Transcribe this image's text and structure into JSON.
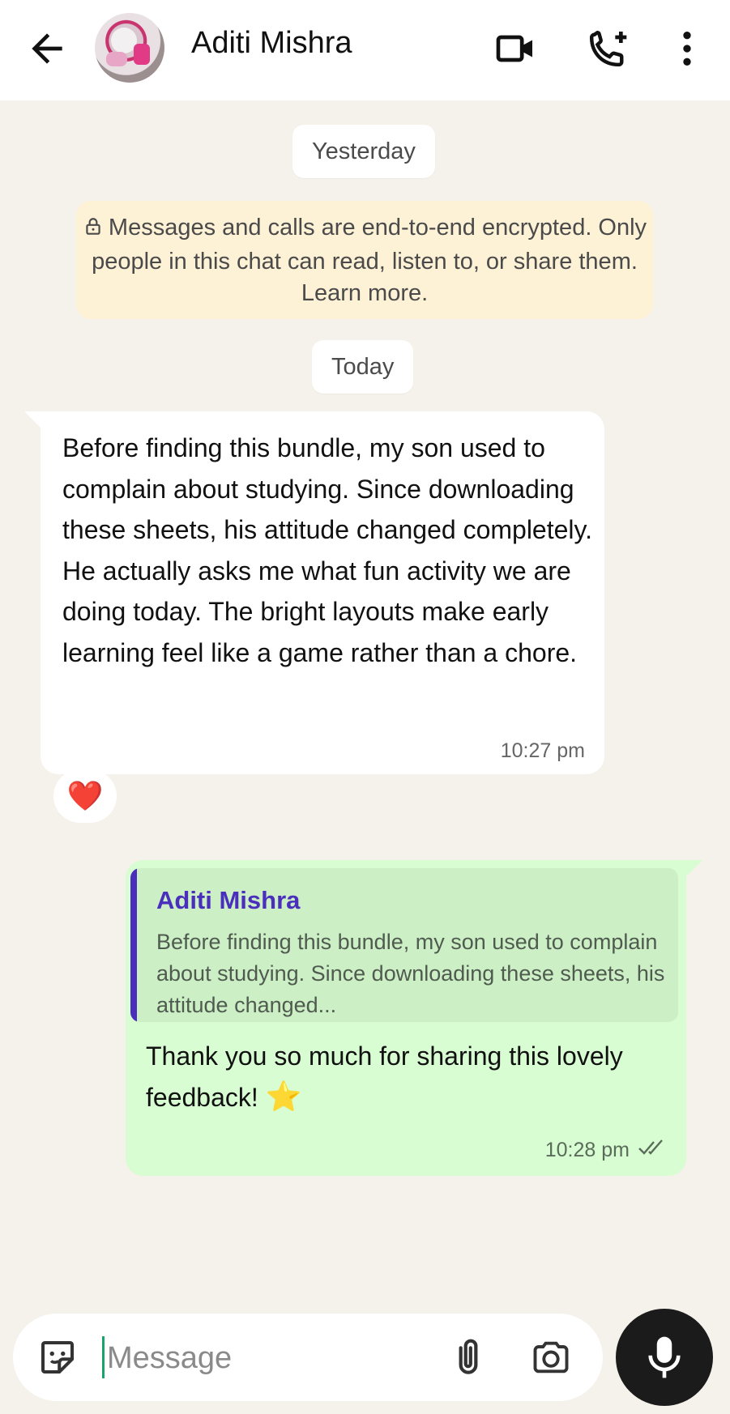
{
  "header": {
    "contact_name": "Aditi Mishra",
    "icons": [
      "back-arrow-icon",
      "video-call-icon",
      "add-call-icon",
      "more-options-icon"
    ]
  },
  "chat": {
    "date_yesterday": "Yesterday",
    "encryption_notice": "Messages and calls are end-to-end encrypted. Only people in this chat can read, listen to, or share them. Learn more.",
    "date_today": "Today",
    "incoming": {
      "text": "Before finding this bundle, my son used to complain about studying. Since downloading these sheets, his attitude changed completely. He actually asks me what fun activity we are doing today. The bright layouts make early learning feel like a game rather than a chore.",
      "time": "10:27 pm",
      "reaction": "❤️"
    },
    "outgoing": {
      "quote_author": "Aditi Mishra",
      "quote_text": "Before finding this bundle, my son used to complain about studying. Since downloading these sheets, his attitude changed...",
      "text": "Thank you so much for sharing this lovely feedback!",
      "emoji": "⭐",
      "time": "10:28 pm",
      "status": "read"
    }
  },
  "composer": {
    "placeholder": "Message",
    "icons": [
      "sticker-icon",
      "attach-icon",
      "camera-icon",
      "mic-icon"
    ]
  },
  "colors": {
    "chat_bg": "#f5f1eb",
    "outgoing_bubble": "#d8fdd2",
    "quote_accent": "#4a2fbd",
    "encryption_bg": "#fdf1d6"
  }
}
